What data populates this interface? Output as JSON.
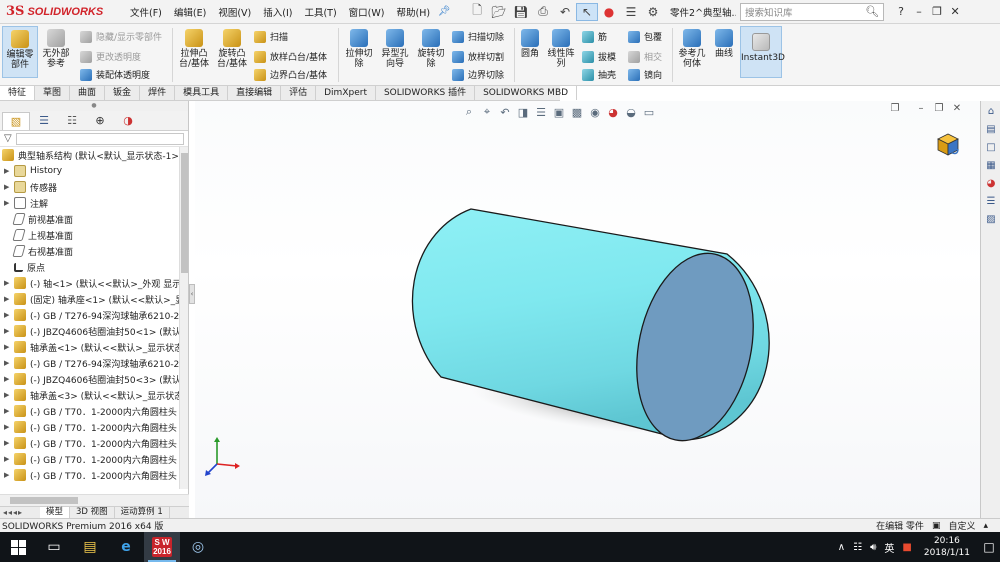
{
  "app": {
    "brand_ds": "3S",
    "brand_sw": "SOLIDWORKS",
    "menu": [
      "文件(F)",
      "编辑(E)",
      "视图(V)",
      "插入(I)",
      "工具(T)",
      "窗口(W)",
      "帮助(H)"
    ],
    "doc_title": "零件2^典型轴...",
    "search_placeholder": "搜索知识库",
    "help_icon_text": "?"
  },
  "command_manager": {
    "edit_part": "编辑零\n部件",
    "no_external": "无外部\n参考",
    "hide_show": "隐藏/显示零部件",
    "change_transparency": "更改透明度",
    "assembly_transparency": "装配体透明度",
    "extruded_boss": "拉伸凸\n台/基体",
    "revolved_boss": "旋转凸\n台/基体",
    "sweep": "扫描",
    "loft": "放样凸台/基体",
    "boundary_boss": "边界凸台/基体",
    "extruded_cut": "拉伸切\n除",
    "hole_wizard": "异型孔\n向导",
    "revolved_cut": "旋转切\n除",
    "swept_cut": "扫描切除",
    "lofted_cut": "放样切割",
    "boundary_cut": "边界切除",
    "fillet": "圆角",
    "linear_pattern": "线性阵\n列",
    "rib": "筋",
    "draft": "拔模",
    "shell": "抽壳",
    "wrap": "包覆",
    "intersect": "相交",
    "mirror": "镜向",
    "ref_geometry": "参考几\n何体",
    "curves": "曲线",
    "instant3d": "Instant3D"
  },
  "tabs": [
    "特征",
    "草图",
    "曲面",
    "钣金",
    "焊件",
    "模具工具",
    "直接编辑",
    "评估",
    "DimXpert",
    "SOLIDWORKS 插件",
    "SOLIDWORKS MBD"
  ],
  "tree": {
    "root": "典型轴系结构  (默认<默认_显示状态-1>)",
    "items": [
      {
        "label": "History",
        "kind": "folder"
      },
      {
        "label": "传感器",
        "kind": "folder"
      },
      {
        "label": "注解",
        "kind": "note"
      },
      {
        "label": "前视基准面",
        "kind": "plane"
      },
      {
        "label": "上视基准面",
        "kind": "plane"
      },
      {
        "label": "右视基准面",
        "kind": "plane"
      },
      {
        "label": "原点",
        "kind": "origin"
      },
      {
        "label": "(-) 轴<1> (默认<<默认>_外观 显示",
        "kind": "comp"
      },
      {
        "label": "(固定) 轴承座<1> (默认<<默认>_显",
        "kind": "comp"
      },
      {
        "label": "(-) GB / T276-94深沟球轴承6210-2",
        "kind": "comp"
      },
      {
        "label": "(-) JBZQ4606毡圈油封50<1> (默认",
        "kind": "comp"
      },
      {
        "label": "轴承盖<1> (默认<<默认>_显示状态",
        "kind": "comp"
      },
      {
        "label": "(-) GB / T276-94深沟球轴承6210-2",
        "kind": "comp"
      },
      {
        "label": "(-) JBZQ4606毡圈油封50<3> (默认",
        "kind": "comp"
      },
      {
        "label": "轴承盖<3> (默认<<默认>_显示状态",
        "kind": "comp"
      },
      {
        "label": "(-) GB / T70．1-2000内六角圆柱头",
        "kind": "comp"
      },
      {
        "label": "(-) GB / T70．1-2000内六角圆柱头",
        "kind": "comp"
      },
      {
        "label": "(-) GB / T70．1-2000内六角圆柱头",
        "kind": "comp"
      },
      {
        "label": "(-) GB / T70．1-2000内六角圆柱头",
        "kind": "comp"
      },
      {
        "label": "(-) GB / T70．1-2000内六角圆柱头",
        "kind": "comp"
      }
    ]
  },
  "bottom_tabs": [
    "模型",
    "3D 视图",
    "运动算例 1"
  ],
  "status": {
    "app_version": "SOLIDWORKS Premium 2016 x64 版",
    "mode": "在编辑 零件",
    "custom": "自定义"
  },
  "taskbar": {
    "sw_tile": "S W\n2016",
    "ime": "英",
    "time": "20:16",
    "date": "2018/1/11"
  },
  "colors": {
    "cylinder_side": "#7fe8ef",
    "cylinder_face": "#6f9bc0",
    "accent": "#d1232a",
    "taskbar": "#101418"
  }
}
